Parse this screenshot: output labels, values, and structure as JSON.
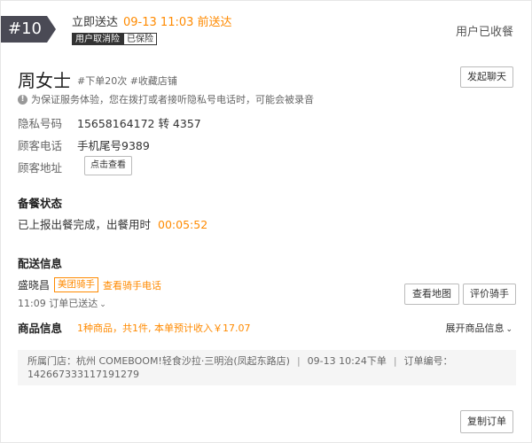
{
  "order": {
    "number": "#10",
    "deliver_label": "立即送达",
    "deliver_time": "09-13 11:03 前送达",
    "tag_cancel": "用户取消险",
    "tag_insured": "已保险",
    "status": "用户已收餐"
  },
  "customer": {
    "name": "周女士",
    "tags": "#下单20次 #收藏店铺",
    "chat_button": "发起聊天",
    "notice": "为保证服务体验，您在拨打或者接听隐私号电话时，可能会被录音",
    "privacy_label": "隐私号码",
    "privacy_value": "15658164172 转 4357",
    "phone_label": "顾客电话",
    "phone_value": "手机尾号9389",
    "address_label": "顾客地址",
    "address_button": "点击查看"
  },
  "prep": {
    "title": "备餐状态",
    "text": "已上报出餐完成，出餐用时",
    "time": "00:05:52"
  },
  "delivery": {
    "title": "配送信息",
    "rider_name": "盛晓昌",
    "rider_badge": "美团骑手",
    "rider_phone": "查看骑手电话",
    "arrived": "11:09 订单已送达",
    "map_button": "查看地图",
    "rate_button": "评价骑手"
  },
  "goods": {
    "title": "商品信息",
    "summary": "1种商品，共1件, 本单预计收入￥17.07",
    "expand": "展开商品信息"
  },
  "footer": {
    "store": "所属门店：杭州 COMEBOOM!轻食沙拉·三明治(凤起东路店)",
    "order_time": "09-13 10:24下单",
    "order_id_label": "订单编号：",
    "order_id": "142667333117191279",
    "sep": "|"
  },
  "actions": {
    "copy_button": "复制订单"
  },
  "colors": {
    "accent": "#ff8a00",
    "badge_bg": "#4a4a55"
  }
}
